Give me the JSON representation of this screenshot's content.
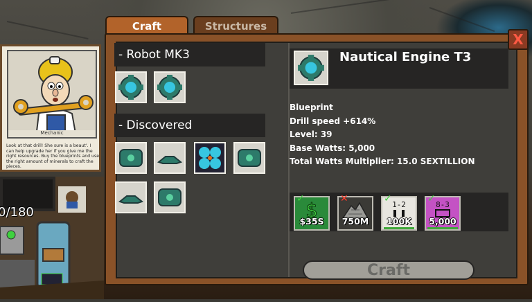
{
  "tabs": {
    "craft": "Craft",
    "structures": "Structures"
  },
  "close_label": "X",
  "mechanic": {
    "name": "Mechanic",
    "text": "Look at that drill! She sure is a beaut'. I can help upgrade her if you give me the right resources. Buy the blueprints and use the right amount of minerals to craft the pieces."
  },
  "depth_label": "0/180",
  "sections": {
    "robot": "- Robot MK3",
    "discovered": "- Discovered"
  },
  "robot_items": [
    "nautical-engine-icon",
    "nautical-engine-icon"
  ],
  "discovered_items": [
    "engine-frame-icon",
    "plate-icon",
    "blue-fan-icon",
    "engine-frame-icon",
    "plate-icon",
    "engine-frame-icon"
  ],
  "detail": {
    "title": "Nautical Engine T3",
    "blueprint": "Blueprint",
    "drill_speed": "Drill speed +614%",
    "level": "Level: 39",
    "base_watts": "Base Watts: 5,000",
    "total_multiplier": "Total Watts Multiplier: 15.0 SEXTILLION"
  },
  "costs": [
    {
      "name": "money",
      "value": "$35S",
      "status": "check",
      "bg": "#2a8a3a"
    },
    {
      "name": "ore",
      "value": "750M",
      "status": "cross",
      "bg": "#3b3a36"
    },
    {
      "name": "mineral-1-2",
      "value": "100K",
      "status": "check",
      "bg": "#e8e6e0"
    },
    {
      "name": "mineral-8-3",
      "value": "5,000",
      "status": "check",
      "bg": "#c452c4"
    }
  ],
  "craft_button": "Craft",
  "colors": {
    "panel": "#8a5228",
    "inner": "#3f3e3a",
    "check": "#3fd13f",
    "cross": "#ff3b2b"
  }
}
